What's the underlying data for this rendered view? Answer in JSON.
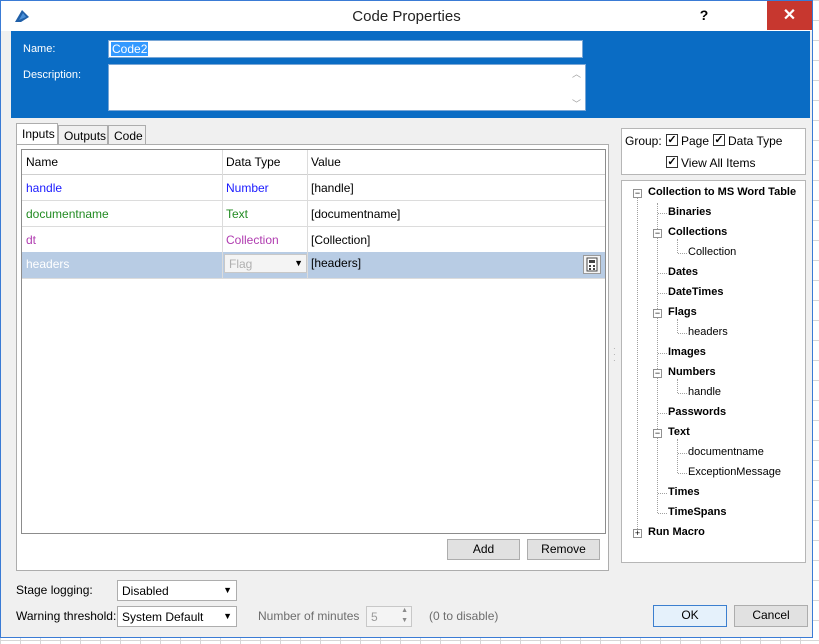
{
  "window": {
    "title": "Code Properties",
    "help": "?",
    "close": "✕"
  },
  "header": {
    "name_label": "Name:",
    "name_value": "Code2",
    "description_label": "Description:",
    "description_value": ""
  },
  "tabs": [
    {
      "label": "Inputs",
      "active": true
    },
    {
      "label": "Outputs",
      "active": false
    },
    {
      "label": "Code",
      "active": false
    }
  ],
  "grid": {
    "columns": [
      "Name",
      "Data Type",
      "Value"
    ],
    "rows": [
      {
        "name": "handle",
        "type": "Number",
        "value": "[handle]",
        "color": "#1a1aff"
      },
      {
        "name": "documentname",
        "type": "Text",
        "value": "[documentname]",
        "color": "#228b22"
      },
      {
        "name": "dt",
        "type": "Collection",
        "value": "[Collection]",
        "color": "#b03cb0"
      },
      {
        "name": "headers",
        "type": "Flag",
        "value": "[headers]",
        "color": "#ffffff"
      }
    ]
  },
  "buttons": {
    "add": "Add",
    "remove": "Remove",
    "ok": "OK",
    "cancel": "Cancel"
  },
  "group": {
    "label": "Group:",
    "page": "Page",
    "data_type": "Data Type",
    "view_all": "View All Items"
  },
  "tree": {
    "root": "Collection to MS Word Table",
    "items": [
      {
        "label": "Binaries"
      },
      {
        "label": "Collections"
      },
      {
        "label": "Collection"
      },
      {
        "label": "Dates"
      },
      {
        "label": "DateTimes"
      },
      {
        "label": "Flags"
      },
      {
        "label": "headers"
      },
      {
        "label": "Images"
      },
      {
        "label": "Numbers"
      },
      {
        "label": "handle"
      },
      {
        "label": "Passwords"
      },
      {
        "label": "Text"
      },
      {
        "label": "documentname"
      },
      {
        "label": "ExceptionMessage"
      },
      {
        "label": "Times"
      },
      {
        "label": "TimeSpans"
      }
    ],
    "root2": "Run Macro"
  },
  "bottom": {
    "stage_logging_label": "Stage logging:",
    "stage_logging_value": "Disabled",
    "warning_label": "Warning threshold:",
    "warning_value": "System Default",
    "minutes_label": "Number of minutes",
    "minutes_value": "5",
    "minutes_hint": "(0 to disable)"
  },
  "colors": {
    "header_bg": "#0a6cc4",
    "selected_row": "#b8cce4",
    "close_btn": "#c7372f"
  }
}
